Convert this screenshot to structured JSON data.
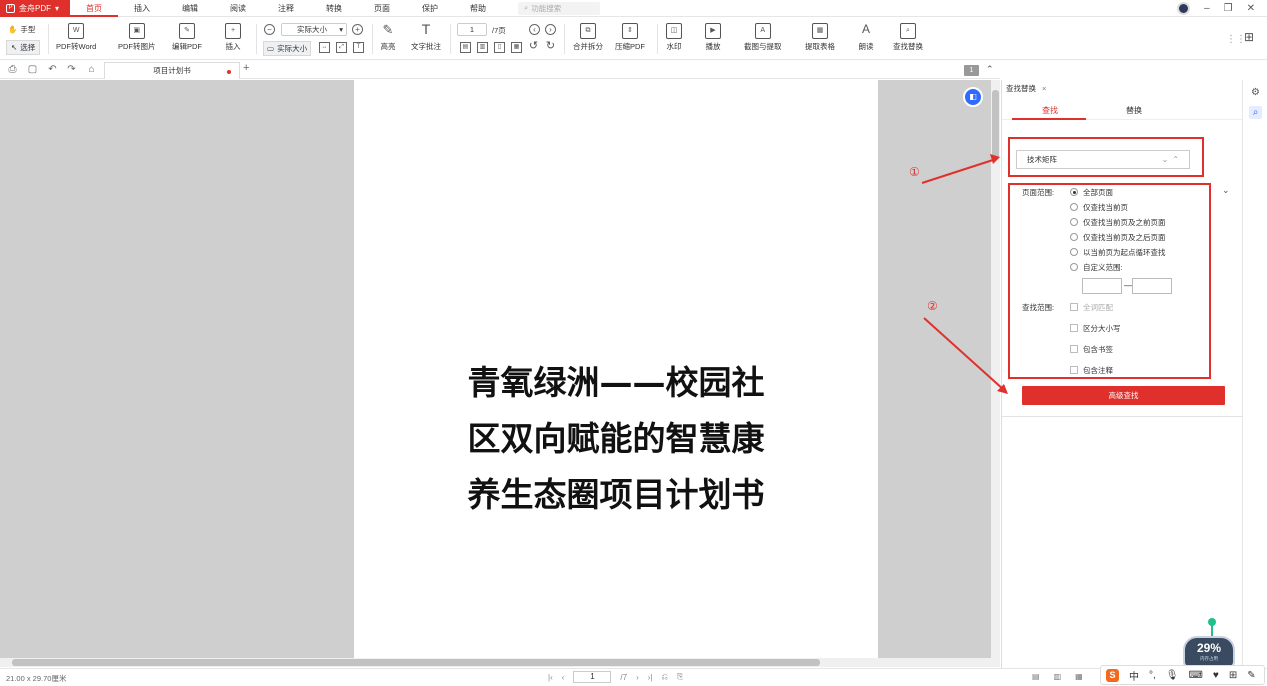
{
  "app": {
    "logo_label": "金舟PDF",
    "menu": [
      "首页",
      "插入",
      "编辑",
      "阅读",
      "注释",
      "转换",
      "页面",
      "保护",
      "帮助"
    ],
    "active_menu": "首页",
    "search_placeholder": "功能搜索"
  },
  "ribbon": {
    "hand_tool": "手型",
    "select_tool": "选择",
    "pdf_to_word": "PDF转Word",
    "pdf_to_image": "PDF转图片",
    "edit_pdf": "编辑PDF",
    "insert": "插入",
    "zoom_value": "实际大小",
    "actual_size": "实际大小",
    "page_current": "1",
    "page_total": "/7页",
    "highlight": "高亮",
    "text_comment": "文字批注",
    "merge_split": "合并拆分",
    "compress_pdf": "压缩PDF",
    "watermark": "水印",
    "play": "播放",
    "screenshot_extract": "截图与提取",
    "extract_table": "提取表格",
    "read_aloud": "朗读",
    "find_replace": "查找替换"
  },
  "tabs": {
    "document_tab": "项目计划书",
    "page_indicator": "1"
  },
  "document": {
    "title_lines": [
      "青氧绿洲——校园社",
      "区双向赋能的智慧康",
      "养生态圈项目计划书"
    ]
  },
  "panel": {
    "tab_title": "查找替换",
    "close": "×",
    "sub_tabs": [
      "查找",
      "替换"
    ],
    "active_sub_tab": "查找",
    "search_value": "技术矩阵",
    "page_range_label": "页面范围:",
    "page_range_options": [
      "全部页面",
      "仅查找当前页",
      "仅查找当前页及之前页面",
      "仅查找当前页及之后页面",
      "以当前页为起点循环查找",
      "自定义范围:"
    ],
    "selected_page_range": "全部页面",
    "range_dash": "—",
    "search_scope_label": "查找范围:",
    "search_scope_options": [
      "全词匹配",
      "区分大小写",
      "包含书签",
      "包含注释"
    ],
    "advanced_button": "高级查找"
  },
  "annotations": {
    "marker_1": "①",
    "marker_2": "②",
    "accent_color": "#e0302c"
  },
  "statusbar": {
    "page_dims": "21.00 x 29.70厘米",
    "page_current": "1",
    "page_total": "/7"
  },
  "widget": {
    "mem_percent": "29%",
    "mem_label": "内存占用"
  },
  "ime": {
    "lang": "中"
  }
}
